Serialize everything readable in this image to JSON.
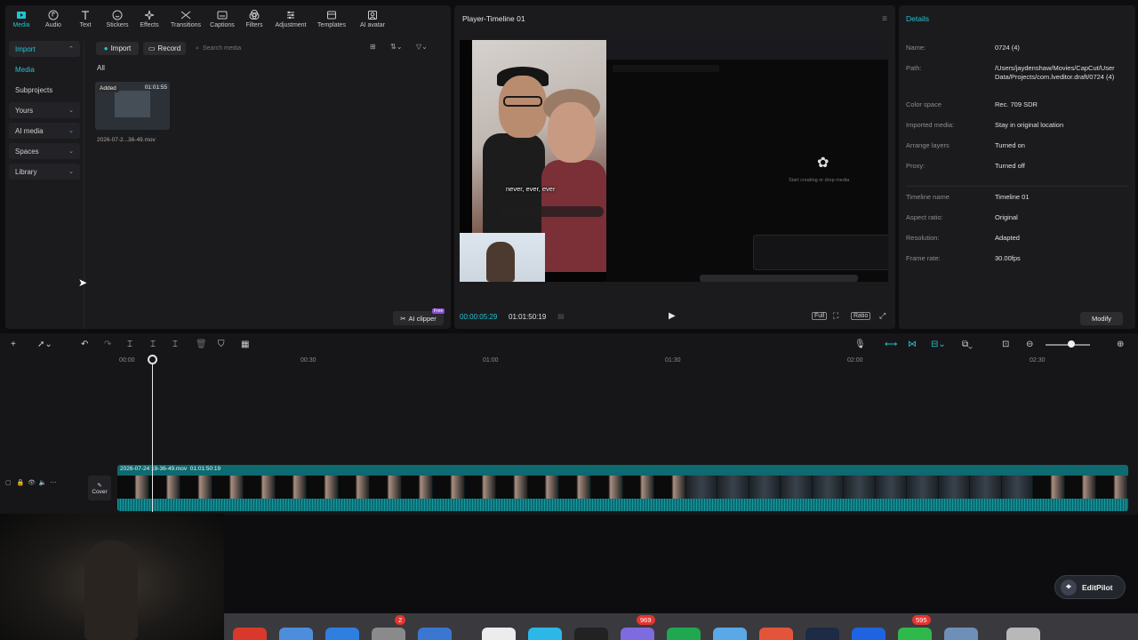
{
  "toolbar": {
    "items": [
      {
        "label": "Media",
        "icon": "media-icon"
      },
      {
        "label": "Audio",
        "icon": "audio-icon"
      },
      {
        "label": "Text",
        "icon": "text-icon"
      },
      {
        "label": "Stickers",
        "icon": "stickers-icon"
      },
      {
        "label": "Effects",
        "icon": "effects-icon"
      },
      {
        "label": "Transitions",
        "icon": "transitions-icon"
      },
      {
        "label": "Captions",
        "icon": "captions-icon"
      },
      {
        "label": "Filters",
        "icon": "filters-icon"
      },
      {
        "label": "Adjustment",
        "icon": "adjustment-icon"
      },
      {
        "label": "Templates",
        "icon": "templates-icon"
      },
      {
        "label": "AI avatar",
        "icon": "ai-avatar-icon"
      }
    ],
    "accent": "#22c3cf"
  },
  "media_nav": {
    "import": "Import",
    "media": "Media",
    "subprojects": "Subprojects",
    "yours": "Yours",
    "ai_media": "AI media",
    "spaces": "Spaces",
    "library": "Library"
  },
  "media": {
    "import_button": "Import",
    "record_button": "Record",
    "search_placeholder": "Search media",
    "filter_all": "All",
    "item": {
      "badge": "Added",
      "duration": "01:01:55",
      "name": "2026-07-2...36-49.mov"
    },
    "ai_clipper": "AI clipper",
    "free_badge": "Free"
  },
  "player": {
    "title": "Player-Timeline 01",
    "caption": "never, ever, ever",
    "screen_hint": "Start creating or drop media",
    "current_time": "00:00:05:29",
    "total_time": "01:01:50:19",
    "full_label": "Full",
    "ratio_label": "Ratio"
  },
  "details": {
    "title": "Details",
    "rows": [
      {
        "key": "Name:",
        "value": "0724 (4)"
      },
      {
        "key": "Path:",
        "value": "/Users/jaydenshaw/Movies/CapCut/User Data/Projects/com.lveditor.draft/0724 (4)"
      },
      {
        "key": "Color space",
        "value": "Rec. 709 SDR"
      },
      {
        "key": "Imported media:",
        "value": "Stay in original location"
      },
      {
        "key": "Arrange layers",
        "value": "Turned on"
      },
      {
        "key": "Proxy:",
        "value": "Turned off"
      },
      {
        "key": "Timeline name",
        "value": "Timeline 01"
      },
      {
        "key": "Aspect ratio:",
        "value": "Original"
      },
      {
        "key": "Resolution:",
        "value": "Adapted"
      },
      {
        "key": "Frame rate:",
        "value": "30.00fps"
      }
    ],
    "modify_button": "Modify"
  },
  "timeline": {
    "ruler": [
      "00:00",
      "00:30",
      "01:00",
      "01:30",
      "02:00",
      "02:30"
    ],
    "clip_name": "2026-07-24 19-36-49.mov",
    "clip_duration": "01:01:50:19",
    "cover_label": "Cover"
  },
  "editpilot": {
    "label": "EditPilot"
  },
  "dock": {
    "badges": [
      {
        "value": "2"
      },
      {
        "value": "969"
      },
      {
        "value": "595"
      }
    ]
  }
}
